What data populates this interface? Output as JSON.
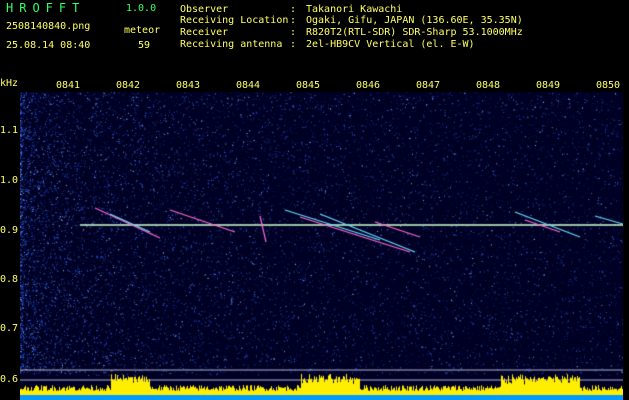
{
  "header": {
    "app_name": "HROFFT",
    "version": "1.0.0",
    "filename": "2508140840.png",
    "timestamp": "25.08.14 08:40",
    "detection_label": "meteor",
    "detection_count": "59"
  },
  "station": [
    {
      "label": "Observer",
      "sep": ":",
      "value": "Takanori Kawachi"
    },
    {
      "label": "Receiving Location",
      "sep": ":",
      "value": "Ogaki, Gifu, JAPAN (136.60E, 35.35N)"
    },
    {
      "label": "Receiver",
      "sep": ":",
      "value": "R820T2(RTL-SDR) SDR-Sharp 53.1000MHz"
    },
    {
      "label": "Receiving antenna",
      "sep": ":",
      "value": "2el-HB9CV Vertical (el. E-W)"
    }
  ],
  "spectrogram": {
    "y_unit": "kHz",
    "time_ticks": [
      "0841",
      "0842",
      "0843",
      "0844",
      "0845",
      "0846",
      "0847",
      "0848",
      "0849",
      "0850"
    ],
    "freq_ticks": [
      "1.1",
      "1.0",
      "0.9",
      "0.8",
      "0.7",
      "0.6"
    ],
    "carrier_khz": 0.91,
    "colors": {
      "background": "#000024",
      "noise": "#2f6cff",
      "carrier": "#ccffcc",
      "echo": "#ff66cc",
      "level_bars": "#ffee00",
      "level_base": "#0099ff",
      "header_text": "#ffff66",
      "title_text": "#33ff66"
    }
  }
}
